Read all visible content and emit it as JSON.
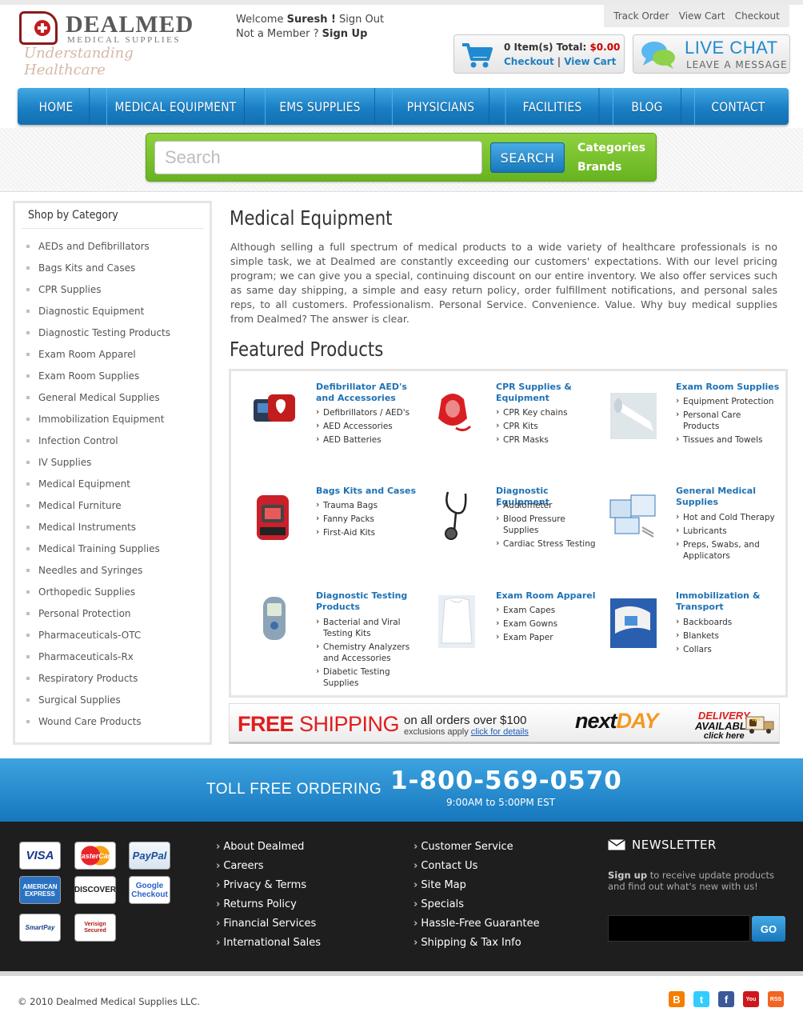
{
  "logo": {
    "name": "DEALMED",
    "subtitle": "MEDICAL SUPPLIES",
    "tagline": "Understanding Healthcare"
  },
  "welcome": {
    "greeting": "Welcome",
    "user": "Suresh !",
    "signout": "Sign Out",
    "not_member": "Not a Member ?",
    "signup": "Sign Up"
  },
  "util_links": [
    "Track Order",
    "View Cart",
    "Checkout"
  ],
  "cart": {
    "items": "0 Item(s) Total:",
    "total": "$0.00",
    "checkout": "Checkout",
    "sep": "|",
    "view_cart": "View Cart"
  },
  "chat": {
    "title": "LIVE CHAT",
    "subtitle": "LEAVE A MESSAGE"
  },
  "nav": [
    "HOME",
    "MEDICAL EQUIPMENT",
    "EMS SUPPLIES",
    "PHYSICIANS",
    "FACILITIES",
    "BLOG",
    "CONTACT"
  ],
  "search": {
    "placeholder": "Search",
    "button": "SEARCH",
    "categories": "Categories",
    "brands": "Brands"
  },
  "sidebar": {
    "title": "Shop by Category",
    "items": [
      "AEDs and Defibrillators",
      "Bags Kits and Cases",
      "CPR Supplies",
      "Diagnostic Equipment",
      "Diagnostic Testing Products",
      "Exam Room Apparel",
      "Exam Room Supplies",
      "General Medical Supplies",
      "Immobilization Equipment",
      "Infection Control",
      "IV Supplies",
      "Medical Equipment",
      "Medical Furniture",
      "Medical Instruments",
      "Medical Training Supplies",
      "Needles and Syringes",
      "Orthopedic Supplies",
      "Personal Protection",
      "Pharmaceuticals-OTC",
      "Pharmaceuticals-Rx",
      "Respiratory Products",
      "Surgical Supplies",
      "Wound Care Products"
    ]
  },
  "main": {
    "title": "Medical Equipment",
    "intro": "Although selling a full spectrum of medical products to a wide variety of healthcare professionals is no simple task, we at Dealmed are constantly exceeding our customers' expectations. With our level pricing program; we can give you a special, continuing discount on our entire inventory. We also offer services such as same day shipping, a simple and easy return policy, order fulfillment notifications, and personal sales reps, to all customers. Professionalism. Personal Service. Convenience. Value. Why buy medical supplies from Dealmed? The answer is clear.",
    "featured_title": "Featured Products"
  },
  "products": [
    {
      "title": "Defibrillator AED's and Accessories",
      "items": [
        "Defibrillators / AED's",
        "AED Accessories",
        "AED Batteries"
      ]
    },
    {
      "title": "CPR Supplies & Equipment",
      "items": [
        "CPR Key chains",
        "CPR Kits",
        "CPR Masks"
      ]
    },
    {
      "title": "Exam Room Supplies",
      "items": [
        "Equipment Protection",
        "Personal Care Products",
        "Tissues and Towels"
      ]
    },
    {
      "title": "Bags Kits and Cases",
      "items": [
        "Trauma Bags",
        "Fanny Packs",
        "First-Aid Kits"
      ]
    },
    {
      "title": "Diagnostic Equipment",
      "items": [
        "Audiometer",
        "Blood Pressure Supplies",
        "Cardiac Stress Testing"
      ]
    },
    {
      "title": "General Medical Supplies",
      "items": [
        "Hot and Cold Therapy",
        "Lubricants",
        "Preps, Swabs, and Applicators"
      ]
    },
    {
      "title": "Diagnostic Testing Products",
      "items": [
        "Bacterial and Viral Testing Kits",
        "Chemistry Analyzers and Accessories",
        "Diabetic Testing Supplies"
      ]
    },
    {
      "title": "Exam Room Apparel",
      "items": [
        "Exam Capes",
        "Exam Gowns",
        "Exam Paper"
      ]
    },
    {
      "title": "Immobilization & Transport",
      "items": [
        "Backboards",
        "Blankets",
        "Collars"
      ]
    }
  ],
  "banner": {
    "free": "FREE",
    "shipping": "SHIPPING",
    "on_orders": "on all orders over $100",
    "exclusions": "exclusions apply",
    "details": "click for details",
    "next": "next",
    "day": "DAY",
    "delivery": "DELIVERY",
    "available": "AVAILABLE",
    "click_here": "click here",
    "ups": "ups"
  },
  "toll": {
    "label": "TOLL FREE ORDERING",
    "number": "1-800-569-0570",
    "hours": "9:00AM to 5:00PM EST"
  },
  "payments": [
    "VISA",
    "MasterCard",
    "PayPal",
    "AMERICAN EXPRESS",
    "DISCOVER",
    "Google Checkout",
    "SmartPay",
    "Verisign Secured"
  ],
  "footer": {
    "col1": [
      "About Dealmed",
      "Careers",
      "Privacy & Terms",
      "Returns Policy",
      "Financial Services",
      "International Sales"
    ],
    "col2": [
      "Customer Service",
      "Contact Us",
      "Site Map",
      "Specials",
      "Hassle-Free Guarantee",
      "Shipping & Tax Info"
    ],
    "newsletter_title": "NEWSLETTER",
    "newsletter_bold": "Sign up",
    "newsletter_text": " to receive update products and find out what's new with us!",
    "go": "GO"
  },
  "copyright": "© 2010 Dealmed Medical Supplies LLC.",
  "social": [
    {
      "name": "blogger-icon",
      "glyph": "B",
      "color": "#f57d00"
    },
    {
      "name": "twitter-icon",
      "glyph": "t",
      "color": "#33ccff"
    },
    {
      "name": "facebook-icon",
      "glyph": "f",
      "color": "#3b5998"
    },
    {
      "name": "youtube-icon",
      "glyph": "You",
      "color": "#cc181e"
    },
    {
      "name": "rss-icon",
      "glyph": "RSS",
      "color": "#f26522"
    }
  ],
  "colors": {
    "brand_blue": "#1a7fc4",
    "green": "#6cb52a",
    "red": "#e01e1e",
    "link_blue": "#1f72b4",
    "footer": "#1e1e1e"
  }
}
